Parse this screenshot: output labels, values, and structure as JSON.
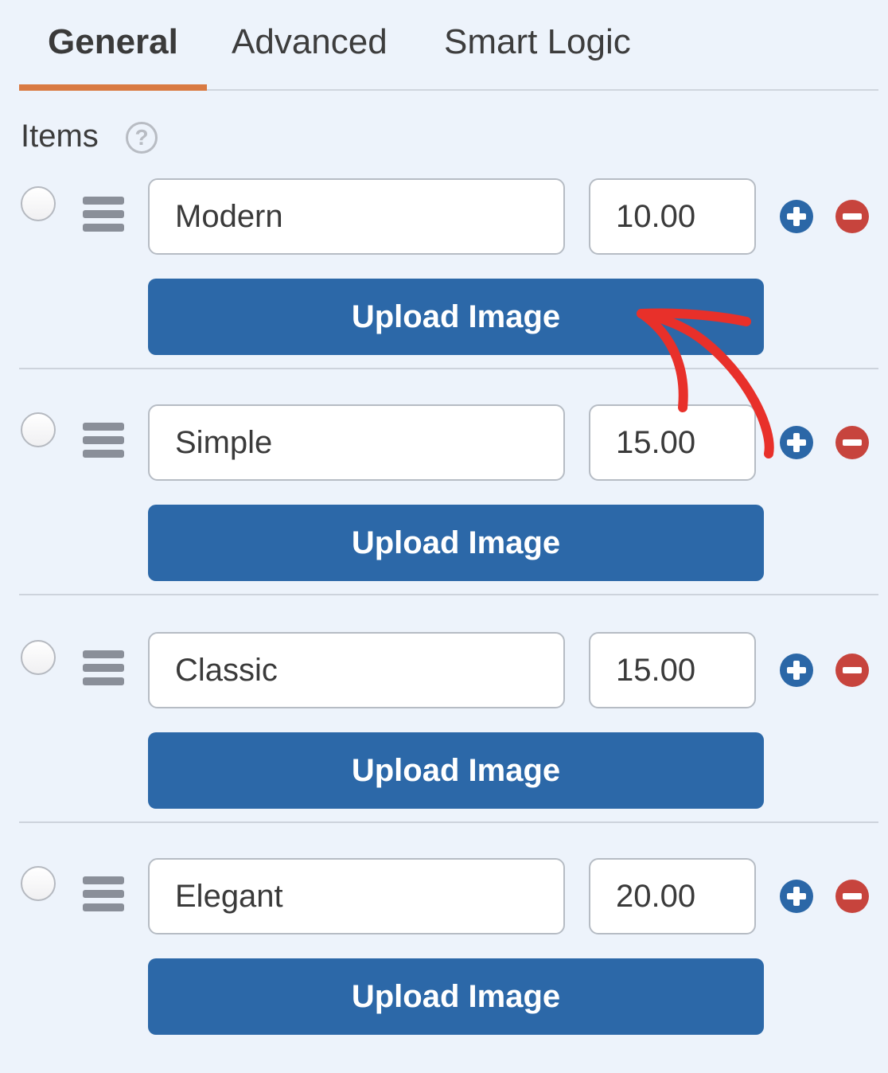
{
  "tabs": [
    {
      "label": "General",
      "active": true
    },
    {
      "label": "Advanced",
      "active": false
    },
    {
      "label": "Smart Logic",
      "active": false
    }
  ],
  "section": {
    "label": "Items",
    "help_icon": "question-circle-icon"
  },
  "items": [
    {
      "name": "Modern",
      "price": "10.00",
      "upload_label": "Upload Image",
      "selected": false
    },
    {
      "name": "Simple",
      "price": "15.00",
      "upload_label": "Upload Image",
      "selected": false
    },
    {
      "name": "Classic",
      "price": "15.00",
      "upload_label": "Upload Image",
      "selected": false
    },
    {
      "name": "Elegant",
      "price": "20.00",
      "upload_label": "Upload Image",
      "selected": false
    }
  ],
  "icons": {
    "drag": "drag-handle-icon",
    "add": "plus-circle-icon",
    "remove": "minus-circle-icon"
  },
  "colors": {
    "background": "#edf3fb",
    "tab_accent": "#d97a42",
    "primary_button": "#2c68a8",
    "add_icon": "#2b67a7",
    "remove_icon": "#c7443d",
    "annotation_arrow": "#e8302a"
  }
}
